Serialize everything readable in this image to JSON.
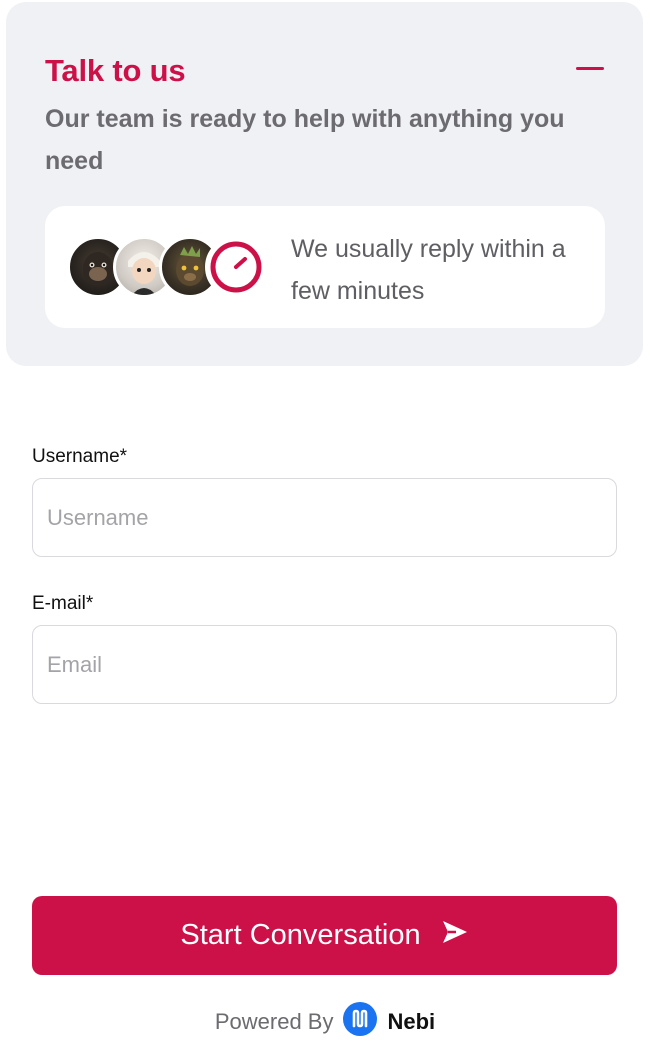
{
  "header": {
    "title": "Talk to us",
    "subtitle": "Our team is ready to help with anything you need",
    "minimize_icon": "minus-icon",
    "accent_color": "#cc1149"
  },
  "reply_card": {
    "avatars": [
      "team-avatar-1",
      "team-avatar-2",
      "team-avatar-3"
    ],
    "clock_icon": "clock-icon",
    "text": "We usually reply within a few minutes"
  },
  "form": {
    "username_label": "Username*",
    "username_placeholder": "Username",
    "username_value": "",
    "email_label": "E-mail*",
    "email_placeholder": "Email",
    "email_value": ""
  },
  "submit": {
    "label": "Start Conversation",
    "icon": "send-icon"
  },
  "footer": {
    "powered_by": "Powered By",
    "brand": "Nebi",
    "brand_icon": "nebi-logo-icon",
    "brand_color": "#1a73f0"
  }
}
